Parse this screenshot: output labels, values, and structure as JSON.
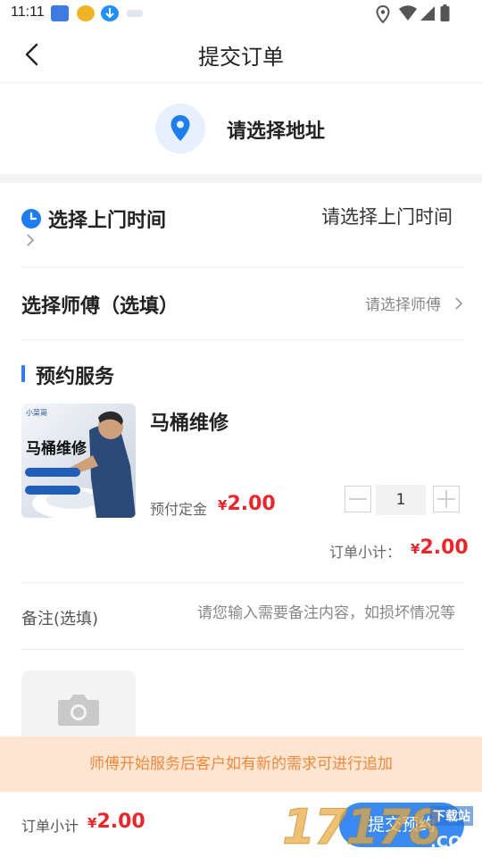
{
  "status_bar": {
    "time": "11:11"
  },
  "header": {
    "title": "提交订单"
  },
  "address": {
    "placeholder_text": "请选择地址",
    "icon": "location-pin-icon"
  },
  "service_time": {
    "label": "选择上门时间",
    "value": "请选择上门时间",
    "icon": "clock-icon"
  },
  "master": {
    "label": "选择师傅（选填）",
    "value": "请选择师傅"
  },
  "section": {
    "title": "预约服务"
  },
  "product": {
    "name": "马桶维修",
    "thumbnail_title": "马桶维修",
    "thumbnail_logo": "小菜哥",
    "deposit_label": "预付定金",
    "currency": "¥",
    "deposit_amount": "2.00",
    "quantity": "1"
  },
  "subtotal": {
    "label": "订单小计：",
    "currency": "¥",
    "amount": "2.00"
  },
  "remark": {
    "label": "备注(选填)",
    "placeholder": "请您输入需要备注内容，如损坏情况等"
  },
  "notice": {
    "text": "师傅开始服务后客户如有新的需求可进行追加"
  },
  "bottom_bar": {
    "label": "订单小计",
    "currency": "¥",
    "amount": "2.00",
    "submit_label": "提交预约"
  },
  "watermark": {
    "text": "17178",
    "suffix": ".COM",
    "tag": "下载站"
  },
  "colors": {
    "accent": "#3a8af3",
    "price": "#e8262c",
    "notice_bg": "#fde5d2",
    "notice_text": "#f08a3c"
  }
}
